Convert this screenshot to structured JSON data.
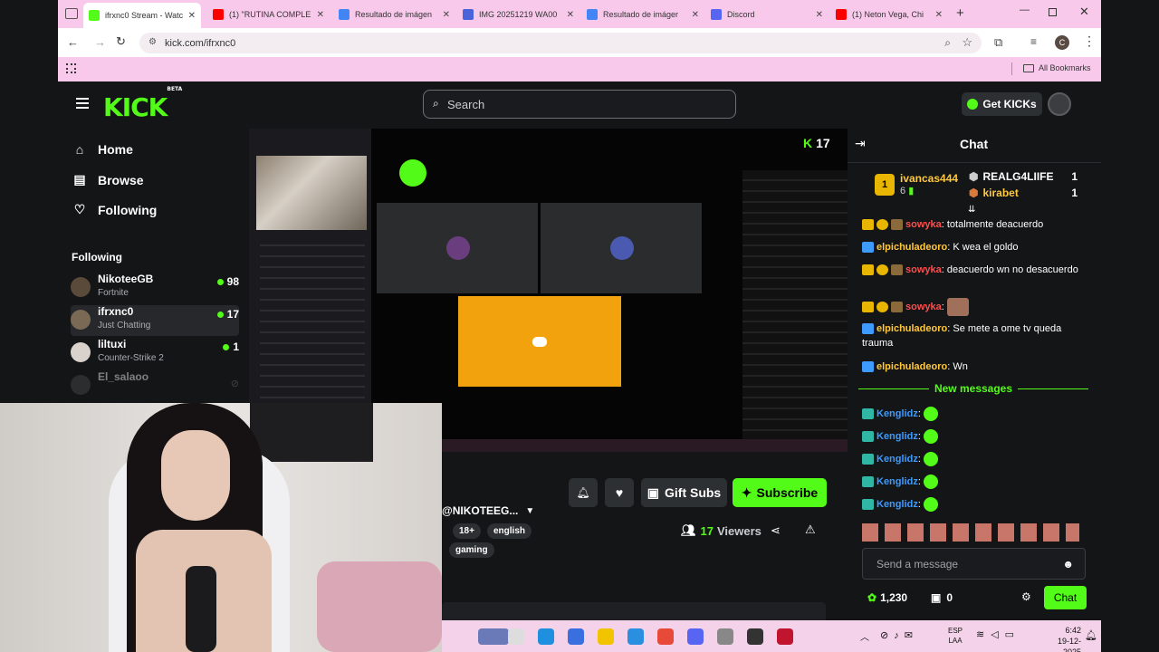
{
  "browser": {
    "tabs": [
      {
        "title": "ifrxnc0 Stream - Watc",
        "color": "#53fc18",
        "active": true
      },
      {
        "title": "(1) \"RUTINA COMPLE",
        "color": "#ff0000",
        "active": false
      },
      {
        "title": "Resultado de imágen",
        "color": "#4285f4",
        "active": false
      },
      {
        "title": "IMG 20251219 WA00",
        "color": "#4a63d8",
        "active": false
      },
      {
        "title": "Resultado de imáger",
        "color": "#4285f4",
        "active": false
      },
      {
        "title": "Discord",
        "color": "#5865f2",
        "active": false
      },
      {
        "title": "(1) Neton Vega, Chi",
        "color": "#ff0000",
        "active": false
      }
    ],
    "url": "kick.com/ifrxnc0",
    "all_bookmarks": "All Bookmarks",
    "profile_initial": "C"
  },
  "kick": {
    "logo": "KICK",
    "logo_tag": "BETA",
    "search_placeholder": "Search",
    "get_kicks": "Get KICKs",
    "nav": [
      {
        "label": "Home",
        "icon": "home-icon"
      },
      {
        "label": "Browse",
        "icon": "browse-icon"
      },
      {
        "label": "Following",
        "icon": "heart-icon"
      }
    ],
    "following_header": "Following",
    "following": [
      {
        "name": "NikoteeGB",
        "category": "Fortnite",
        "viewers": "98"
      },
      {
        "name": "ifrxnc0",
        "category": "Just Chatting",
        "viewers": "17"
      },
      {
        "name": "liltuxi",
        "category": "Counter-Strike 2",
        "viewers": "1"
      },
      {
        "name": "El_salaoo",
        "category": "",
        "viewers": ""
      }
    ],
    "stream_viewer_overlay": "17",
    "channel_name": "@NIKOTEEG...",
    "tags": [
      "18+",
      "english",
      "gaming"
    ],
    "viewers_count": "17",
    "viewers_label": "Viewers",
    "gift_subs": "Gift Subs",
    "subscribe": "Subscribe",
    "chat": {
      "title": "Chat",
      "leaderboard": [
        {
          "rank": "1",
          "name": "ivancas444",
          "value": "6"
        },
        {
          "rank": "",
          "name": "REALG4LIIFE",
          "value": "1"
        },
        {
          "rank": "",
          "name": "kirabet",
          "value": "1"
        }
      ],
      "messages": [
        {
          "user": "sowyka",
          "color": "#ff4d4d",
          "text": "totalmente deacuerdo"
        },
        {
          "user": "elpichuladeoro",
          "color": "#ffc83d",
          "text": "K wea el goldo"
        },
        {
          "user": "sowyka",
          "color": "#ff4d4d",
          "text": "deacuerdo wn no desacuerdo"
        },
        {
          "user": "sowyka",
          "color": "#ff4d4d",
          "text": ""
        },
        {
          "user": "elpichuladeoro",
          "color": "#ffc83d",
          "text": "Se mete a ome tv queda trauma"
        },
        {
          "user": "elpichuladeoro",
          "color": "#ffc83d",
          "text": "Wn"
        }
      ],
      "new_messages": "New messages",
      "new": [
        {
          "user": "Kenglidz",
          "color": "#3d9bff"
        },
        {
          "user": "Kenglidz",
          "color": "#3d9bff"
        },
        {
          "user": "Kenglidz",
          "color": "#3d9bff"
        },
        {
          "user": "Kenglidz",
          "color": "#3d9bff"
        },
        {
          "user": "Kenglidz",
          "color": "#3d9bff"
        }
      ],
      "input_placeholder": "Send a message",
      "points": "1,230",
      "gifts": "0",
      "send": "Chat"
    }
  },
  "taskbar": {
    "lang": "ESP",
    "lang2": "LAA",
    "time": "6:42",
    "date": "19-12-2025"
  },
  "colors": {
    "kick_green": "#53fc18",
    "bg": "#141517"
  }
}
